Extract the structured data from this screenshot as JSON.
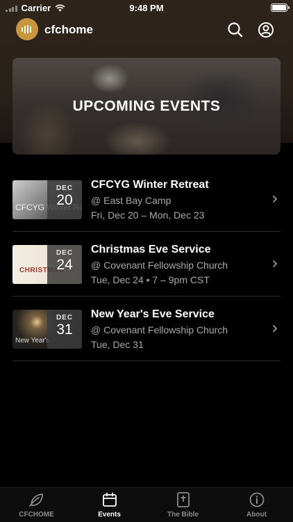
{
  "status": {
    "carrier": "Carrier",
    "time": "9:48 PM"
  },
  "header": {
    "title": "cfchome"
  },
  "banner": {
    "title": "UPCOMING EVENTS"
  },
  "events": [
    {
      "month": "DEC",
      "day": "20",
      "title": "CFCYG Winter Retreat",
      "location": "@ East Bay Camp",
      "time": "Fri, Dec 20 – Mon, Dec 23",
      "thumb_text": "CFCYG Winter Re"
    },
    {
      "month": "DEC",
      "day": "24",
      "title": "Christmas Eve Service",
      "location": "@ Covenant Fellowship Church",
      "time": "Tue, Dec 24 • 7 – 9pm CST",
      "thumb_text": "CHRISTMAS"
    },
    {
      "month": "DEC",
      "day": "31",
      "title": "New Year's Eve Service",
      "location": "@ Covenant Fellowship Church",
      "time": "Tue, Dec 31",
      "thumb_text": "New Year's"
    }
  ],
  "tabs": [
    {
      "label": "CFCHOME",
      "icon": "leaf-icon",
      "active": false
    },
    {
      "label": "Events",
      "icon": "calendar-icon",
      "active": true
    },
    {
      "label": "The Bible",
      "icon": "bible-icon",
      "active": false
    },
    {
      "label": "About",
      "icon": "info-icon",
      "active": false
    }
  ],
  "colors": {
    "accent": "#c9953f",
    "background": "#000000",
    "header_bg": "#2e241c",
    "secondary_text": "#a8a8a8"
  }
}
